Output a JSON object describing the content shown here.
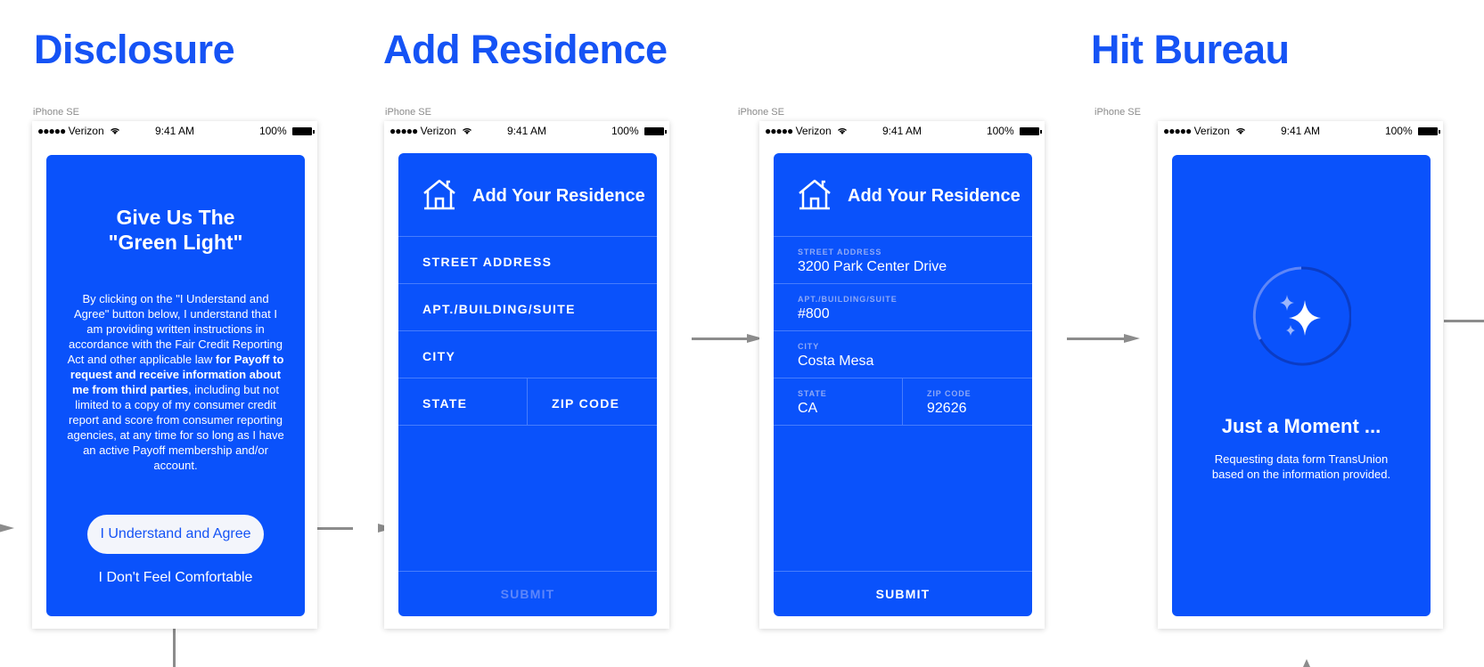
{
  "sections": {
    "disclosure": "Disclosure",
    "add_residence": "Add Residence",
    "hit_bureau": "Hit Bureau"
  },
  "device": "iPhone SE",
  "status_bar": {
    "dots": "●●●●●",
    "carrier": "Verizon",
    "time": "9:41 AM",
    "battery": "100%"
  },
  "disclosure_screen": {
    "title_line1": "Give Us The",
    "title_line2": "\"Green Light\"",
    "body_intro": "By clicking on the \"I Understand and Agree\" button below, I understand that I am providing written instructions in accordance with the Fair Credit Reporting Act and other applicable law ",
    "body_bold": "for Payoff to request and receive information about me from third parties",
    "body_rest": ", including but not limited to a copy of my consumer credit report and score from consumer reporting agencies, at any time for so long as I have an active Payoff membership and/or account.",
    "agree_button": "I Understand and Agree",
    "decline_link": "I Don't Feel Comfortable"
  },
  "residence_empty": {
    "title": "Add Your Residence",
    "fields": {
      "street": "STREET ADDRESS",
      "apt": "APT./BUILDING/SUITE",
      "city": "CITY",
      "state": "STATE",
      "zip": "ZIP CODE"
    },
    "submit": "SUBMIT"
  },
  "residence_filled": {
    "title": "Add Your Residence",
    "fields": {
      "street_label": "STREET ADDRESS",
      "street_value": "3200 Park Center Drive",
      "apt_label": "APT./BUILDING/SUITE",
      "apt_value": "#800",
      "city_label": "CITY",
      "city_value": "Costa Mesa",
      "state_label": "STATE",
      "state_value": "CA",
      "zip_label": "ZIP CODE",
      "zip_value": "92626"
    },
    "submit": "SUBMIT"
  },
  "bureau_screen": {
    "title": "Just a Moment ...",
    "body": "Requesting data form TransUnion based on the information provided."
  },
  "colors": {
    "brand_blue": "#1553f5",
    "card_blue": "#0a52fb",
    "connector_gray": "#8c8c8c"
  },
  "icons": [
    "wifi-icon",
    "battery-icon",
    "house-icon",
    "sparkle-icon",
    "spinner-ring"
  ]
}
